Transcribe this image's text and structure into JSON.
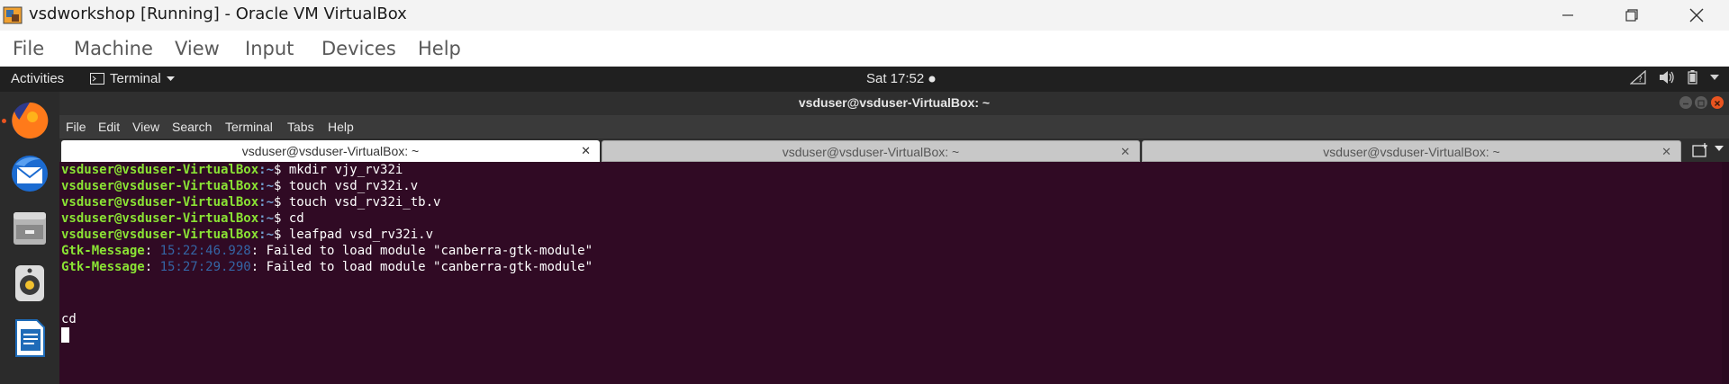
{
  "host": {
    "title": "vsdworkshop [Running] - Oracle VM VirtualBox",
    "menu": [
      "File",
      "Machine",
      "View",
      "Input",
      "Devices",
      "Help"
    ]
  },
  "ubuntu": {
    "activities": "Activities",
    "app_menu": "Terminal",
    "clock": "Sat 17:52"
  },
  "terminal": {
    "title": "vsduser@vsduser-VirtualBox: ~",
    "menu": [
      "File",
      "Edit",
      "View",
      "Search",
      "Terminal",
      "Tabs",
      "Help"
    ],
    "tabs": [
      {
        "label": "vsduser@vsduser-VirtualBox: ~",
        "active": true
      },
      {
        "label": "vsduser@vsduser-VirtualBox: ~",
        "active": false
      },
      {
        "label": "vsduser@vsduser-VirtualBox: ~",
        "active": false
      }
    ],
    "prompt_user": "vsduser@vsduser-VirtualBox",
    "prompt_path": ":~",
    "prompt_symbol": "$ ",
    "commands": [
      "mkdir vjy_rv32i",
      "touch vsd_rv32i.v",
      "touch vsd_rv32i_tb.v",
      "cd",
      "leafpad vsd_rv32i.v"
    ],
    "gtk_messages": [
      {
        "key": "Gtk-Message",
        "sep": ": ",
        "time": "15:22:46.928",
        "text": ": Failed to load module \"canberra-gtk-module\""
      },
      {
        "key": "Gtk-Message",
        "sep": ": ",
        "time": "15:27:29.290",
        "text": ": Failed to load module \"canberra-gtk-module\""
      }
    ],
    "typed_line": "cd"
  },
  "colors": {
    "terminal_bg": "#300a24",
    "prompt_user": "#8ae234",
    "prompt_path": "#729fcf",
    "ubuntu_orange": "#e95420"
  },
  "dock_icons": [
    "firefox-icon",
    "thunderbird-icon",
    "files-icon",
    "rhythmbox-icon",
    "libreoffice-writer-icon"
  ]
}
